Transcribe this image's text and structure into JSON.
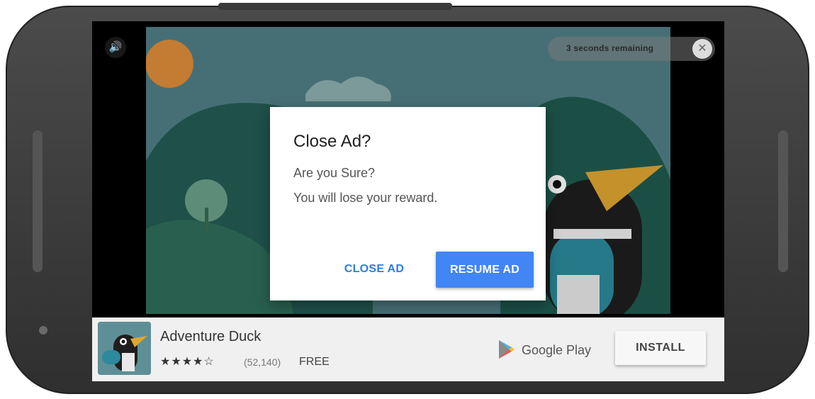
{
  "ad": {
    "timer_text": "3 seconds remaining",
    "close_x": "✕",
    "sound_icon": "🔊"
  },
  "dialog": {
    "title": "Close Ad?",
    "line1": "Are you Sure?",
    "line2": "You will lose your reward.",
    "close_label": "CLOSE AD",
    "resume_label": "RESUME AD"
  },
  "app": {
    "name": "Adventure Duck",
    "stars": "★★★★☆",
    "rating_count": "(52,140)",
    "price": "FREE",
    "store": "Google Play",
    "install_label": "INSTALL"
  },
  "colors": {
    "primary_blue": "#4285f4",
    "link_blue": "#2e7be8",
    "scene_teal": "#4f7f83"
  }
}
